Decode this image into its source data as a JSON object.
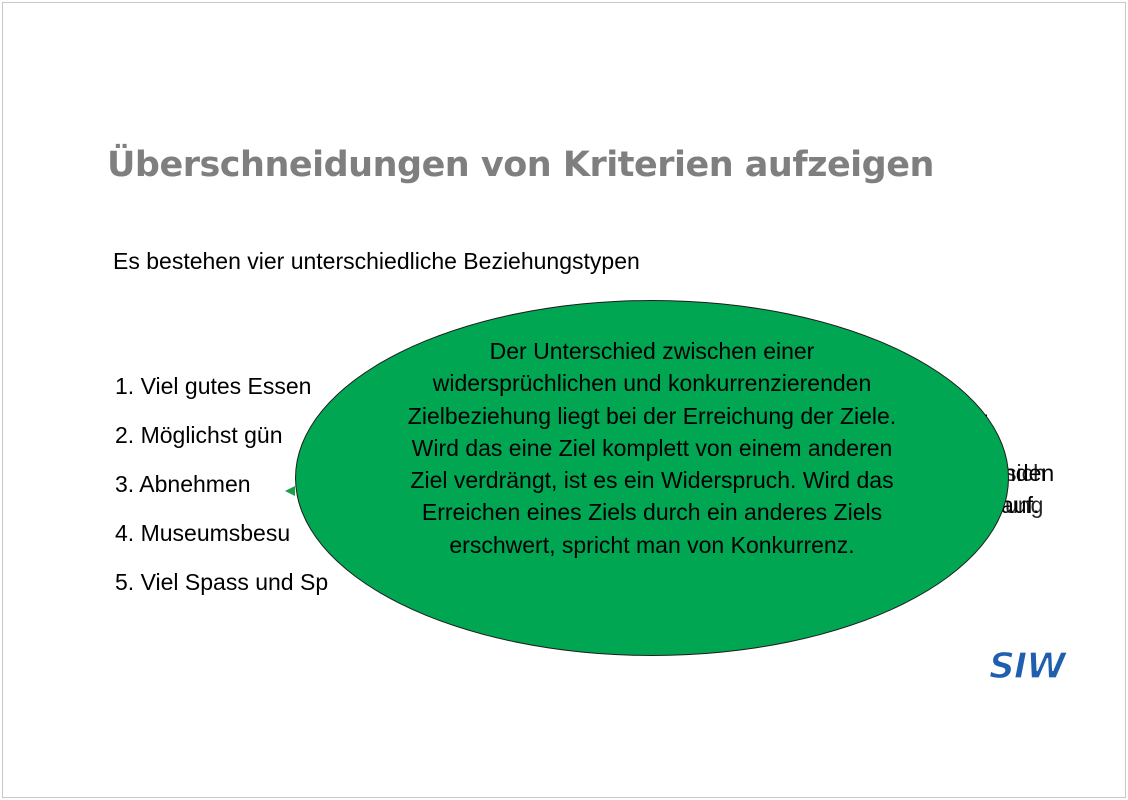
{
  "slide": {
    "title": "Überschneidungen von Kriterien aufzeigen",
    "subtitle": "Es bestehen vier unterschiedliche Beziehungstypen",
    "list_items": [
      "1. Viel gutes Essen",
      "2. Möglichst gün",
      "3. Abnehmen",
      "4. Museumsbesu",
      "5. Viel Spass und Sp"
    ],
    "right_fragments": [
      "ng",
      "nden",
      "sich",
      "auf.",
      "ung"
    ],
    "callout_text": "Der Unterschied zwischen einer widersprüchlichen und konkurrenzierenden Zielbeziehung liegt bei der Erreichung der Ziele. Wird das eine Ziel komplett von einem anderen Ziel verdrängt, ist es ein Widerspruch. Wird das Erreichen eines Ziels durch ein anderes Ziels erschwert, spricht man von Konkurrenz.",
    "logo_text": "SIW",
    "colors": {
      "title": "#7f7f7f",
      "callout_fill": "#00a651",
      "logo": "#1f5fae"
    },
    "icons": {
      "logo": "siw-logo",
      "arrow": "arrowhead-icon"
    }
  }
}
